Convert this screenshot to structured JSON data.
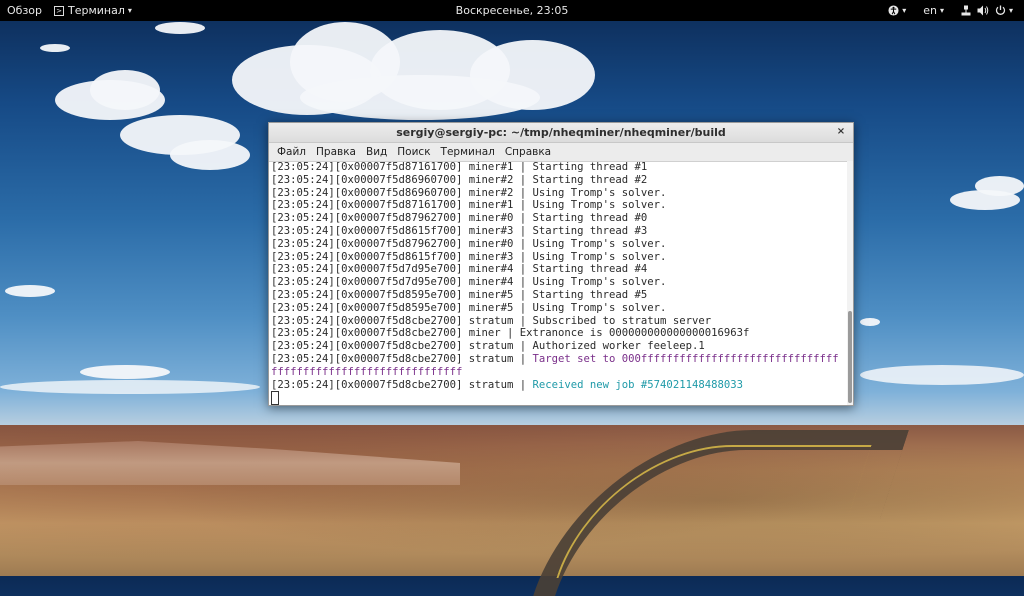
{
  "topbar": {
    "overview": "Обзор",
    "app_name": "Терминал",
    "clock": "Воскресенье, 23:05",
    "language": "en"
  },
  "window": {
    "title": "sergiy@sergiy-pc: ~/tmp/nheqminer/nheqminer/build",
    "close": "×",
    "menu": [
      "Файл",
      "Правка",
      "Вид",
      "Поиск",
      "Терминал",
      "Справка"
    ]
  },
  "terminal": {
    "lines": [
      {
        "prefix": "[23:05:24][0x00007f5d87161700] miner#1 | ",
        "text": "Starting thread #1",
        "style": "normal"
      },
      {
        "prefix": "[23:05:24][0x00007f5d86960700] miner#2 | ",
        "text": "Starting thread #2",
        "style": "normal"
      },
      {
        "prefix": "[23:05:24][0x00007f5d86960700] miner#2 | ",
        "text": "Using Tromp's solver.",
        "style": "normal"
      },
      {
        "prefix": "[23:05:24][0x00007f5d87161700] miner#1 | ",
        "text": "Using Tromp's solver.",
        "style": "normal"
      },
      {
        "prefix": "[23:05:24][0x00007f5d87962700] miner#0 | ",
        "text": "Starting thread #0",
        "style": "normal"
      },
      {
        "prefix": "[23:05:24][0x00007f5d8615f700] miner#3 | ",
        "text": "Starting thread #3",
        "style": "normal"
      },
      {
        "prefix": "[23:05:24][0x00007f5d87962700] miner#0 | ",
        "text": "Using Tromp's solver.",
        "style": "normal"
      },
      {
        "prefix": "[23:05:24][0x00007f5d8615f700] miner#3 | ",
        "text": "Using Tromp's solver.",
        "style": "normal"
      },
      {
        "prefix": "[23:05:24][0x00007f5d7d95e700] miner#4 | ",
        "text": "Starting thread #4",
        "style": "normal"
      },
      {
        "prefix": "[23:05:24][0x00007f5d7d95e700] miner#4 | ",
        "text": "Using Tromp's solver.",
        "style": "normal"
      },
      {
        "prefix": "[23:05:24][0x00007f5d8595e700] miner#5 | ",
        "text": "Starting thread #5",
        "style": "normal"
      },
      {
        "prefix": "[23:05:24][0x00007f5d8595e700] miner#5 | ",
        "text": "Using Tromp's solver.",
        "style": "normal"
      },
      {
        "prefix": "[23:05:24][0x00007f5d8cbe2700] stratum | ",
        "text": "Subscribed to stratum server",
        "style": "normal"
      },
      {
        "prefix": "[23:05:24][0x00007f5d8cbe2700] miner | ",
        "text": "Extranonce is 000000000000000016963f",
        "style": "normal"
      },
      {
        "prefix": "[23:05:24][0x00007f5d8cbe2700] stratum | ",
        "text": "Authorized worker feeleep.1",
        "style": "normal"
      },
      {
        "prefix": "[23:05:24][0x00007f5d8cbe2700] stratum | ",
        "text": "Target set to 000fffffffffffffffffffffffffffffff",
        "style": "purple"
      },
      {
        "prefix": "",
        "text": "ffffffffffffffffffffffffffffff",
        "style": "purple"
      },
      {
        "prefix": "[23:05:24][0x00007f5d8cbe2700] stratum | ",
        "text": "Received new job #574021148488033",
        "style": "cyan"
      }
    ]
  }
}
